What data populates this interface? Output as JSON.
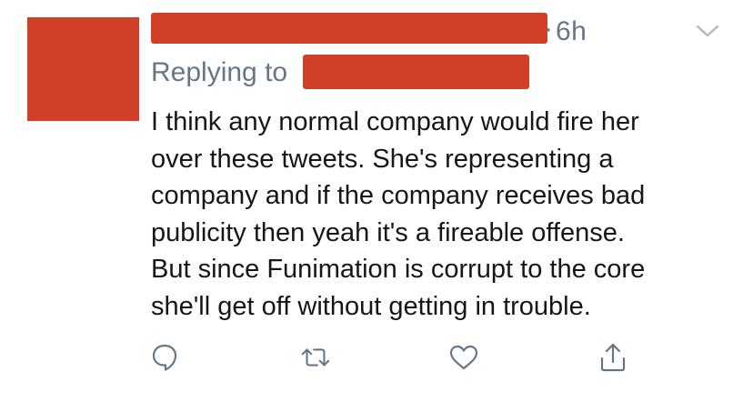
{
  "tweet": {
    "time": "6h",
    "separator": "·",
    "replying_to_label": "Replying to",
    "text": "I think any normal company would fire her\nover these tweets. She's representing a\ncompany and if the company receives bad\npublicity then yeah it's a fireable offense.\nBut since Funimation is corrupt to the core\nshe'll get off without getting in trouble."
  },
  "actions": [
    {
      "icon": "reply-icon"
    },
    {
      "icon": "retweet-icon"
    },
    {
      "icon": "heart-icon"
    },
    {
      "icon": "share-icon"
    }
  ],
  "colors": {
    "redaction": "#d13f28",
    "secondary_text": "#657786",
    "primary_text": "#14171a"
  }
}
